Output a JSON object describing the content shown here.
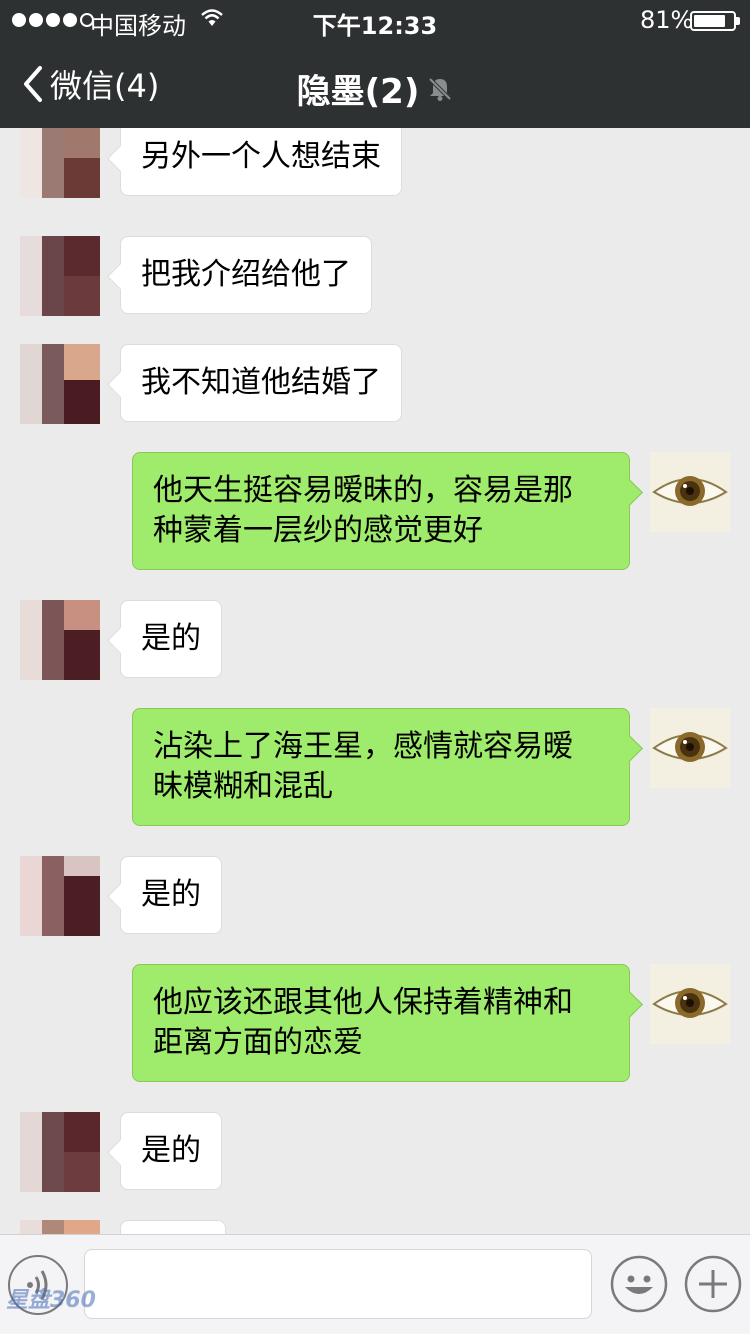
{
  "status_bar": {
    "carrier": "中国移动",
    "time": "下午12:33",
    "battery_percent": "81%",
    "battery_level": 0.81,
    "signal_bars_filled": 4,
    "signal_bars_total": 5
  },
  "nav": {
    "back_label": "微信(4)",
    "title": "隐墨(2)",
    "title_icon": "muted-bell-icon"
  },
  "messages": [
    {
      "side": "in",
      "text": "另外一个人想结束"
    },
    {
      "side": "in",
      "text": "把我介绍给他了"
    },
    {
      "side": "in",
      "text": "我不知道他结婚了"
    },
    {
      "side": "out",
      "line1": "他天生挺容易暧昧的，容易是那",
      "line2": "种蒙着一层纱的感觉更好"
    },
    {
      "side": "in",
      "text": "是的"
    },
    {
      "side": "out",
      "line1": "沾染上了海王星，感情就容易暧",
      "line2": "昧模糊和混乱"
    },
    {
      "side": "in",
      "text": "是的"
    },
    {
      "side": "out",
      "line1": "他应该还跟其他人保持着精神和",
      "line2": "距离方面的恋爱"
    },
    {
      "side": "in",
      "text": "是的"
    }
  ],
  "input_bar": {
    "voice_icon": "voice-icon",
    "emoji_icon": "emoji-icon",
    "plus_icon": "plus-icon",
    "input_value": ""
  },
  "watermark": {
    "text": "星盘360"
  },
  "colors": {
    "nav_bg": "#2e3132",
    "chat_bg": "#ebebeb",
    "bubble_in": "#ffffff",
    "bubble_out": "#9feb6b"
  }
}
